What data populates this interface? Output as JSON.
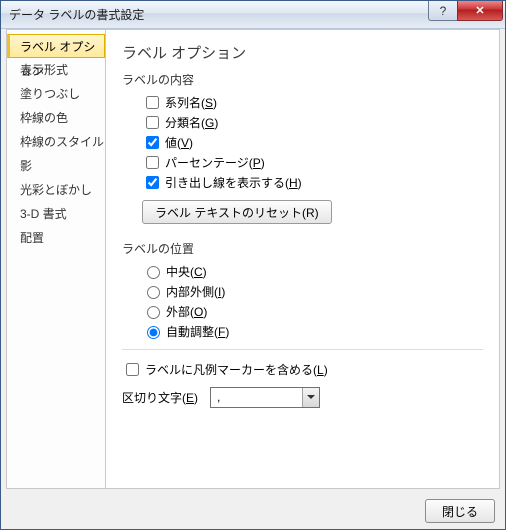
{
  "window": {
    "title": "データ ラベルの書式設定"
  },
  "sidebar": {
    "items": [
      {
        "label": "ラベル オプション",
        "selected": true
      },
      {
        "label": "表示形式",
        "selected": false
      },
      {
        "label": "塗りつぶし",
        "selected": false
      },
      {
        "label": "枠線の色",
        "selected": false
      },
      {
        "label": "枠線のスタイル",
        "selected": false
      },
      {
        "label": "影",
        "selected": false
      },
      {
        "label": "光彩とぼかし",
        "selected": false
      },
      {
        "label": "3-D 書式",
        "selected": false
      },
      {
        "label": "配置",
        "selected": false
      }
    ]
  },
  "main": {
    "heading": "ラベル オプション",
    "content_group": "ラベルの内容",
    "options": {
      "series": {
        "label": "系列名",
        "accel": "S",
        "checked": false
      },
      "category": {
        "label": "分類名",
        "accel": "G",
        "checked": false
      },
      "value": {
        "label": "値",
        "accel": "V",
        "checked": true
      },
      "percent": {
        "label": "パーセンテージ",
        "accel": "P",
        "checked": false
      },
      "leader": {
        "label": "引き出し線を表示する",
        "accel": "H",
        "checked": true
      }
    },
    "reset_label": "ラベル テキストのリセット(R)",
    "position_group": "ラベルの位置",
    "positions": {
      "center": {
        "label": "中央",
        "accel": "C"
      },
      "inside": {
        "label": "内部外側",
        "accel": "I"
      },
      "outside": {
        "label": "外部",
        "accel": "O"
      },
      "bestfit": {
        "label": "自動調整",
        "accel": "F"
      }
    },
    "position_selected": "bestfit",
    "legend_key": {
      "label": "ラベルに凡例マーカーを含める",
      "accel": "L",
      "checked": false
    },
    "separator": {
      "label": "区切り文字",
      "accel": "E",
      "value": ","
    }
  },
  "footer": {
    "close": "閉じる"
  }
}
